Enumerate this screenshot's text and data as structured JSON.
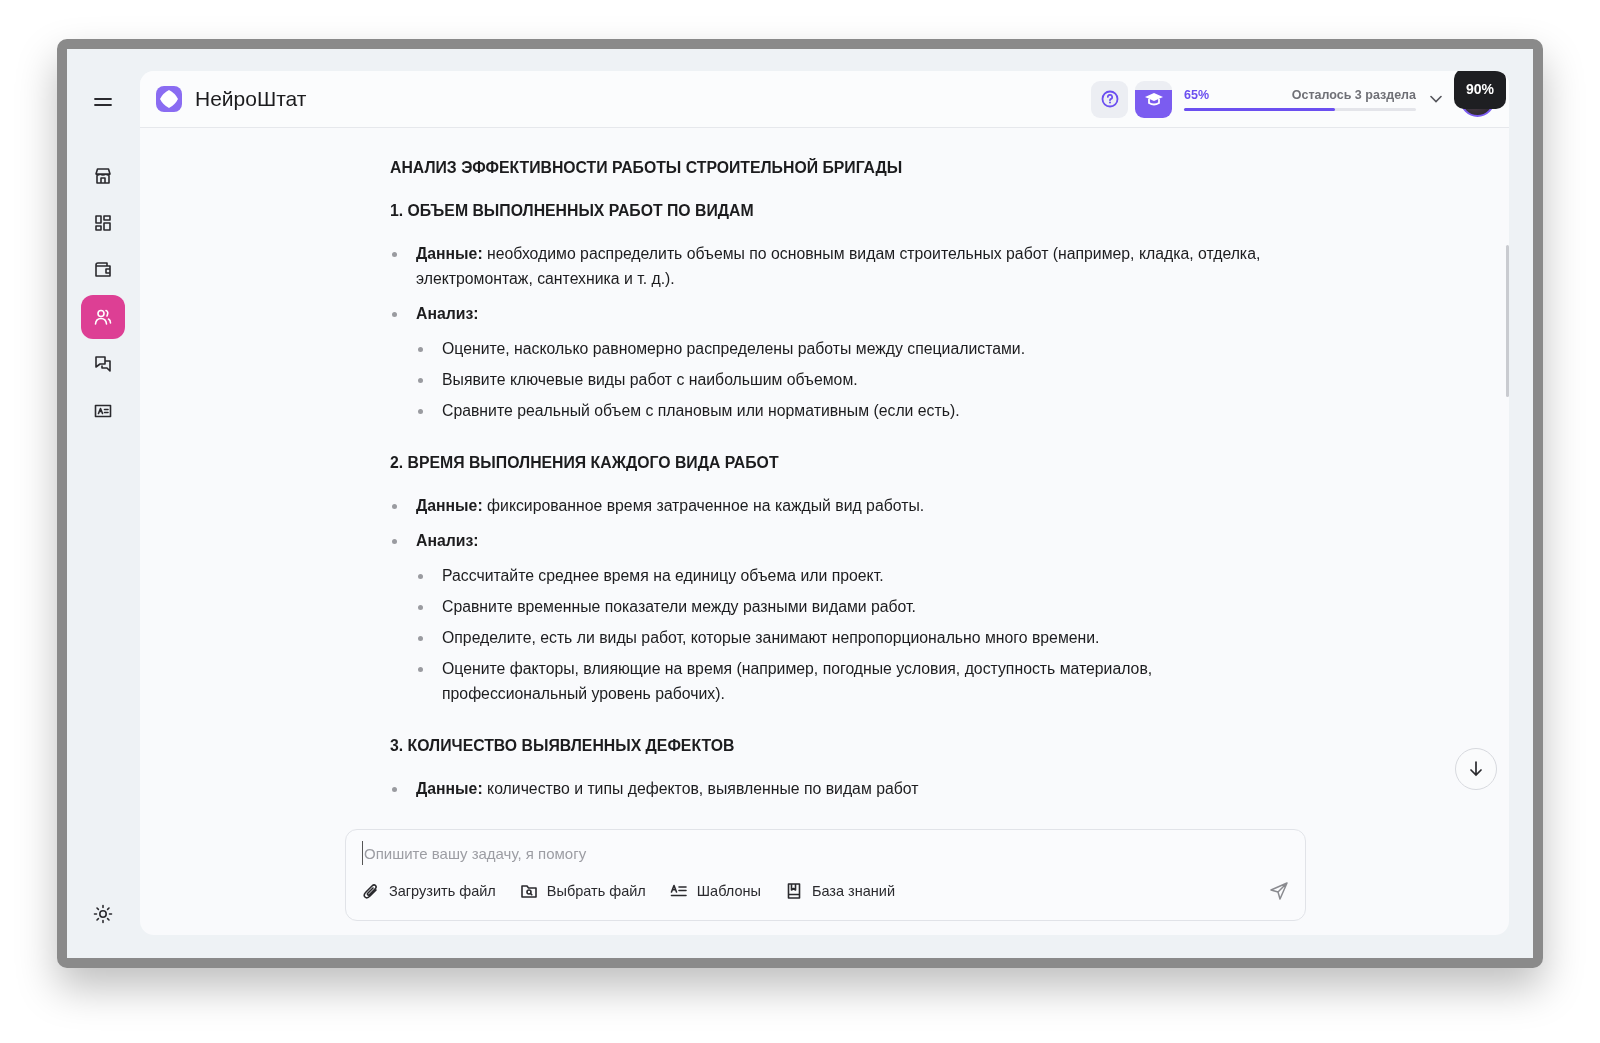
{
  "app": {
    "name": "НейроШтат"
  },
  "sidebar": {
    "items": [
      {
        "kind": "store",
        "selected": false
      },
      {
        "kind": "grid",
        "selected": false
      },
      {
        "kind": "wallet",
        "selected": false
      },
      {
        "kind": "people",
        "selected": true
      },
      {
        "kind": "chat",
        "selected": false
      },
      {
        "kind": "card",
        "selected": false
      }
    ]
  },
  "header": {
    "progress": {
      "percent": "65%",
      "level": 0.65,
      "remaining": "Осталось 3 раздела"
    },
    "tooltip": "90%"
  },
  "document": {
    "title": "АНАЛИЗ ЭФФЕКТИВНОСТИ РАБОТЫ СТРОИТЕЛЬНОЙ БРИГАДЫ",
    "sections": [
      {
        "heading": "1. ОБЪЕМ ВЫПОЛНЕННЫХ РАБОТ ПО ВИДАМ",
        "items": [
          {
            "label": "Данные:",
            "text": "необходимо распределить объемы по основным видам строительных работ (например, кладка, отделка, электромонтаж, сантехника и т. д.)."
          },
          {
            "label": "Анализ:",
            "children": [
              "Оцените, насколько равномерно распределены работы между специалистами.",
              "Выявите ключевые виды работ с наибольшим объемом.",
              "Сравните реальный объем с плановым или нормативным (если есть)."
            ]
          }
        ]
      },
      {
        "heading": "2. ВРЕМЯ ВЫПОЛНЕНИЯ КАЖДОГО ВИДА РАБОТ",
        "items": [
          {
            "label": "Данные:",
            "text": "фиксированное время затраченное на каждый вид работы."
          },
          {
            "label": "Анализ:",
            "children": [
              "Рассчитайте среднее время на единицу объема или проект.",
              "Сравните временные показатели между разными видами работ.",
              "Определите, есть ли виды работ, которые занимают непропорционально много времени.",
              "Оцените факторы, влияющие на время (например, погодные условия, доступность материалов, профессиональный уровень рабочих)."
            ]
          }
        ]
      },
      {
        "heading": "3. КОЛИЧЕСТВО ВЫЯВЛЕННЫХ ДЕФЕКТОВ",
        "items": [
          {
            "label": "Данные:",
            "text": "количество и типы дефектов, выявленные по видам работ"
          }
        ]
      }
    ]
  },
  "composer": {
    "placeholder": "Опишите вашу задачу, я помогу",
    "tools": [
      {
        "kind": "attach",
        "label": "Загрузить файл"
      },
      {
        "kind": "folder",
        "label": "Выбрать файл"
      },
      {
        "kind": "templates",
        "label": "Шаблоны"
      },
      {
        "kind": "knowledge",
        "label": "База знаний"
      }
    ]
  }
}
